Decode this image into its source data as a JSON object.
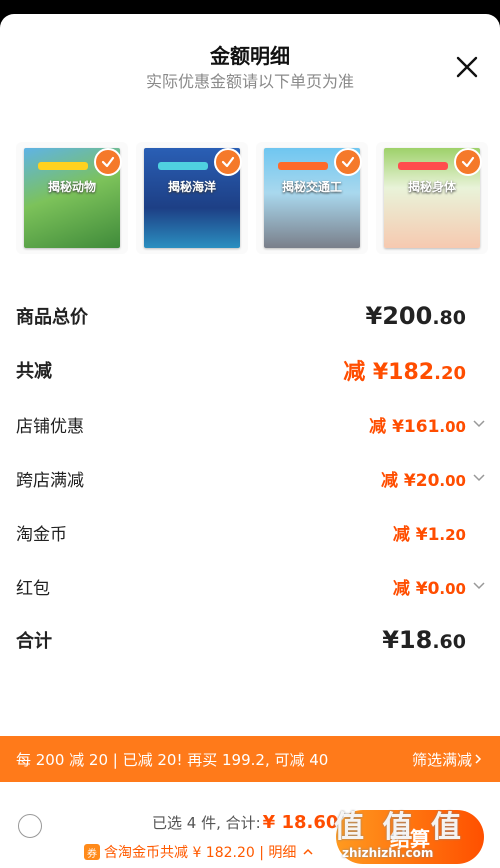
{
  "header": {
    "title": "金额明细",
    "subtitle": "实际优惠金额请以下单页为准",
    "close_icon": "close-icon"
  },
  "products": [
    {
      "title": "揭秘动物",
      "color": "#2f8a3a"
    },
    {
      "title": "揭秘海洋",
      "color": "#1e4fa0"
    },
    {
      "title": "揭秘交通工",
      "color": "#2a7fc0"
    },
    {
      "title": "揭秘身体",
      "color": "#8fc14a"
    }
  ],
  "rows": {
    "goods_total": {
      "label": "商品总价",
      "currency": "¥",
      "int": "200",
      "dec": ".80"
    },
    "total_reduce": {
      "label": "共减",
      "prefix": "减 ",
      "currency": "¥",
      "int": "182",
      "dec": ".20"
    },
    "shop_discount": {
      "label": "店铺优惠",
      "prefix": "减 ",
      "currency": "¥",
      "int": "161",
      "dec": ".00"
    },
    "cross_store": {
      "label": "跨店满减",
      "prefix": "减 ",
      "currency": "¥",
      "int": "20",
      "dec": ".00"
    },
    "tao_coin": {
      "label": "淘金币",
      "prefix": "减 ",
      "currency": "¥",
      "int": "1",
      "dec": ".20"
    },
    "red_packet": {
      "label": "红包",
      "prefix": "减 ",
      "currency": "¥",
      "int": "0",
      "dec": ".00"
    },
    "sum": {
      "label": "合计",
      "currency": "¥",
      "int": "18",
      "dec": ".60"
    }
  },
  "promo": {
    "text": "每 200 减 20 | 已减 20! 再买 199.2, 可减 40",
    "filter_label": "筛选满减"
  },
  "bottom": {
    "selected_text": "已选 4 件, 合计:",
    "selected_total": "¥ 18.60",
    "coin_badge": "券",
    "coin_text": "含淘金币共减 ¥ 182.20 | 明细",
    "checkout_label": "结算"
  },
  "watermark": {
    "text": "值 值 值",
    "url": "zhizhizhi.com"
  },
  "colors": {
    "accent": "#ff4d00",
    "promo_bg": "#ff7a1a",
    "check": "#f5792a"
  }
}
